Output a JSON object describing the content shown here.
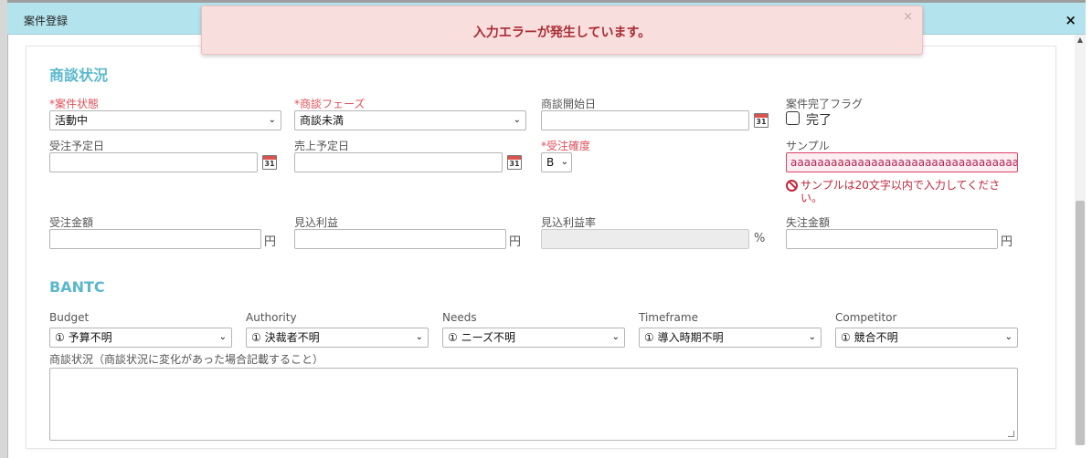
{
  "modal": {
    "title": "案件登録",
    "close_icon": "×"
  },
  "alert": {
    "message": "入力エラーが発生しています。",
    "close_icon": "×"
  },
  "sections": {
    "status": "商談状況",
    "bantc": "BANTC"
  },
  "fields": {
    "case_status": {
      "required_mark": "*",
      "label": "案件状態",
      "value": "活動中"
    },
    "phase": {
      "required_mark": "*",
      "label": "商談フェーズ",
      "value": "商談未満"
    },
    "start_date": {
      "label": "商談開始日",
      "value": ""
    },
    "complete_flag": {
      "label": "案件完了フラグ",
      "option": "完了",
      "checked": false
    },
    "order_date": {
      "label": "受注予定日",
      "value": ""
    },
    "sales_date": {
      "label": "売上予定日",
      "value": ""
    },
    "order_prob": {
      "required_mark": "*",
      "label": "受注確度",
      "value": "B"
    },
    "sample": {
      "label": "サンプル",
      "value": "aaaaaaaaaaaaaaaaaaaaaaaaaaaaaaaaaaaaaaaa",
      "error": "サンプルは20文字以内で入力してください。"
    },
    "order_amount": {
      "label": "受注金額",
      "unit": "円",
      "value": ""
    },
    "expected_profit": {
      "label": "見込利益",
      "unit": "円",
      "value": ""
    },
    "profit_rate": {
      "label": "見込利益率",
      "unit": "%",
      "value": ""
    },
    "lost_amount": {
      "label": "失注金額",
      "unit": "円",
      "value": ""
    }
  },
  "bantc": {
    "budget": {
      "label": "Budget",
      "value": "① 予算不明"
    },
    "authority": {
      "label": "Authority",
      "value": "① 決裁者不明"
    },
    "needs": {
      "label": "Needs",
      "value": "① ニーズ不明"
    },
    "timeframe": {
      "label": "Timeframe",
      "value": "① 導入時期不明"
    },
    "competitor": {
      "label": "Competitor",
      "value": "① 競合不明"
    }
  },
  "notes": {
    "label": "商談状況（商談状況に変化があった場合記載すること）",
    "value": ""
  },
  "calendar_day": "31",
  "chevron": "⌄",
  "colors": {
    "accent": "#5bb8cc",
    "error": "#c1263c",
    "titlebar": "#b3e3ec",
    "alert_bg": "#f9dede"
  }
}
